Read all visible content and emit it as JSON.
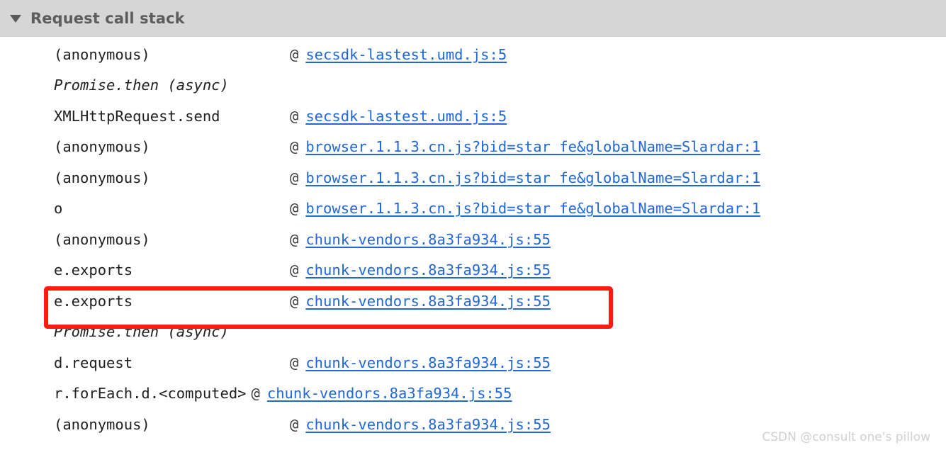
{
  "header": {
    "title": "Request call stack",
    "disclosure_icon": "triangle-down-icon",
    "expanded": true,
    "background_color": "#d6d6d6",
    "text_color": "#5d5d5d"
  },
  "colors": {
    "link": "#2167d8",
    "highlight_border": "#fc1b0c",
    "text": "#1f1f1f",
    "watermark": "#d0d0d0",
    "page_background": "#ffffff"
  },
  "call_stack": {
    "at_symbol": "@",
    "rows": [
      {
        "function": "(anonymous)",
        "source": "secsdk-lastest.umd.js:5",
        "async": false,
        "highlighted": false,
        "wide": false
      },
      {
        "function": "Promise.then (async)",
        "source": "",
        "async": true,
        "highlighted": false,
        "wide": false
      },
      {
        "function": "XMLHttpRequest.send",
        "source": "secsdk-lastest.umd.js:5",
        "async": false,
        "highlighted": false,
        "wide": false
      },
      {
        "function": "(anonymous)",
        "source": "browser.1.1.3.cn.js?bid=star_fe&globalName=Slardar:1",
        "async": false,
        "highlighted": false,
        "wide": false
      },
      {
        "function": "(anonymous)",
        "source": "browser.1.1.3.cn.js?bid=star_fe&globalName=Slardar:1",
        "async": false,
        "highlighted": false,
        "wide": false
      },
      {
        "function": "o",
        "source": "browser.1.1.3.cn.js?bid=star_fe&globalName=Slardar:1",
        "async": false,
        "highlighted": false,
        "wide": false
      },
      {
        "function": "(anonymous)",
        "source": "chunk-vendors.8a3fa934.js:55",
        "async": false,
        "highlighted": false,
        "wide": false
      },
      {
        "function": "e.exports",
        "source": "chunk-vendors.8a3fa934.js:55",
        "async": false,
        "highlighted": false,
        "wide": false
      },
      {
        "function": "e.exports",
        "source": "chunk-vendors.8a3fa934.js:55",
        "async": false,
        "highlighted": true,
        "wide": false
      },
      {
        "function": "Promise.then (async)",
        "source": "",
        "async": true,
        "highlighted": false,
        "wide": false
      },
      {
        "function": "d.request",
        "source": "chunk-vendors.8a3fa934.js:55",
        "async": false,
        "highlighted": false,
        "wide": false
      },
      {
        "function": "r.forEach.d.<computed>",
        "source": "chunk-vendors.8a3fa934.js:55",
        "async": false,
        "highlighted": false,
        "wide": true
      },
      {
        "function": "(anonymous)",
        "source": "chunk-vendors.8a3fa934.js:55",
        "async": false,
        "highlighted": false,
        "wide": false
      }
    ]
  },
  "watermark": {
    "text": "CSDN @consult one's pillow"
  }
}
